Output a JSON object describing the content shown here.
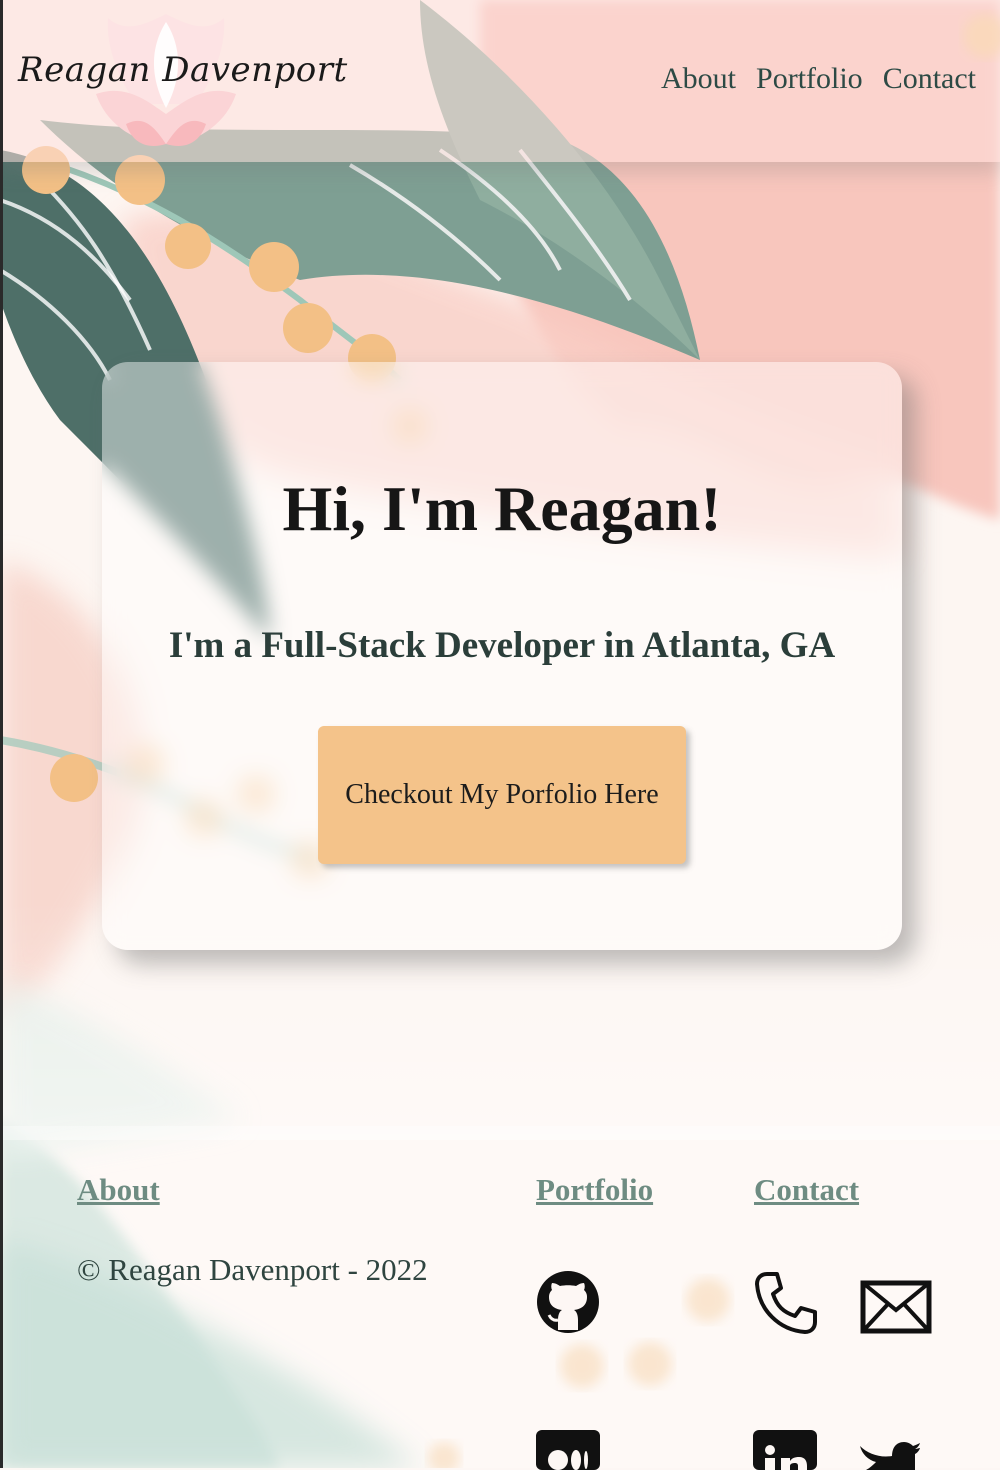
{
  "header": {
    "logo_text": "Reagan Davenport",
    "nav": [
      {
        "label": "About"
      },
      {
        "label": "Portfolio"
      },
      {
        "label": "Contact"
      }
    ]
  },
  "hero": {
    "heading": "Hi, I'm Reagan!",
    "subheading": "I'm a Full-Stack Developer in Atlanta, GA",
    "cta_label": "Checkout My Porfolio Here"
  },
  "footer": {
    "about_link": "About",
    "portfolio_link": "Portfolio",
    "contact_link": "Contact",
    "copyright": "© Reagan Davenport - 2022",
    "icons": [
      "github-icon",
      "phone-icon",
      "mail-icon",
      "medium-icon",
      "linkedin-icon",
      "twitter-icon"
    ]
  },
  "colors": {
    "header_bg": "#fddeda",
    "cta_bg": "#f4c38a",
    "footer_link": "#6e8c82",
    "leaf_dark": "#4f7069",
    "leaf_light": "#8fada1",
    "berry": "#f3c086",
    "blush": "#f8c4bb"
  }
}
